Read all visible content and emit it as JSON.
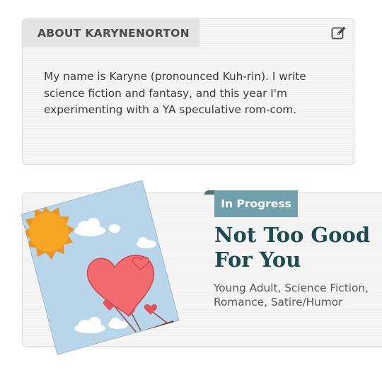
{
  "about": {
    "heading": "ABOUT KARYNENORTON",
    "bio": "My name is Karyne (pronounced Kuh-rin). I write science fiction and fantasy, and this year I'm experimenting with a YA speculative rom-com.",
    "edit_icon": "edit-pencil-icon"
  },
  "project": {
    "status": "In Progress",
    "title": "Not Too Good For You",
    "genres": "Young Adult, Science Fiction, Romance, Satire/Humor",
    "cover_image": "heart-hot-air-balloon-cover"
  },
  "colors": {
    "status_tag": "#6fa0ab",
    "title_text": "#1c4b52",
    "cover_sky": "#b9d5ea",
    "sun": "#f6a623",
    "heart": "#f36a6f",
    "basket": "#8e5a3c"
  }
}
